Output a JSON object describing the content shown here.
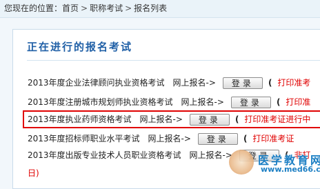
{
  "breadcrumb": {
    "prefix": "您现在的位置：",
    "items": [
      "首页",
      "职称考试",
      "报名列表"
    ],
    "separator": ">"
  },
  "section_title": "正在进行的报名考试",
  "button_label": "登录",
  "rows": [
    {
      "name": "2013年度企业法律顾问执业资格考试",
      "online": "网上报名->",
      "paren": "(",
      "print": "打印准考"
    },
    {
      "name": "2013年度注册城市规划师执业资格考试",
      "online": "网上报名->",
      "paren": "(",
      "print": "打印准"
    },
    {
      "name": "2013年度执业药师资格考试",
      "online": "网上报名->",
      "paren": "(",
      "print": "打印准考证进行中"
    },
    {
      "name": "2013年度招标师职业水平考试",
      "online": "网上报名->",
      "paren": "(",
      "print": "打印准考证"
    },
    {
      "name": "2013年度出版专业技术人员职业资格考试",
      "online": "网上报名->",
      "paren": "(",
      "print": "非打"
    }
  ],
  "trailing_text": "日)",
  "watermark": {
    "text": "医学教育网",
    "url": "www.med66.com"
  },
  "colors": {
    "accent": "#1f5fa6",
    "highlight": "#e00000",
    "print_link": "#e00000"
  }
}
